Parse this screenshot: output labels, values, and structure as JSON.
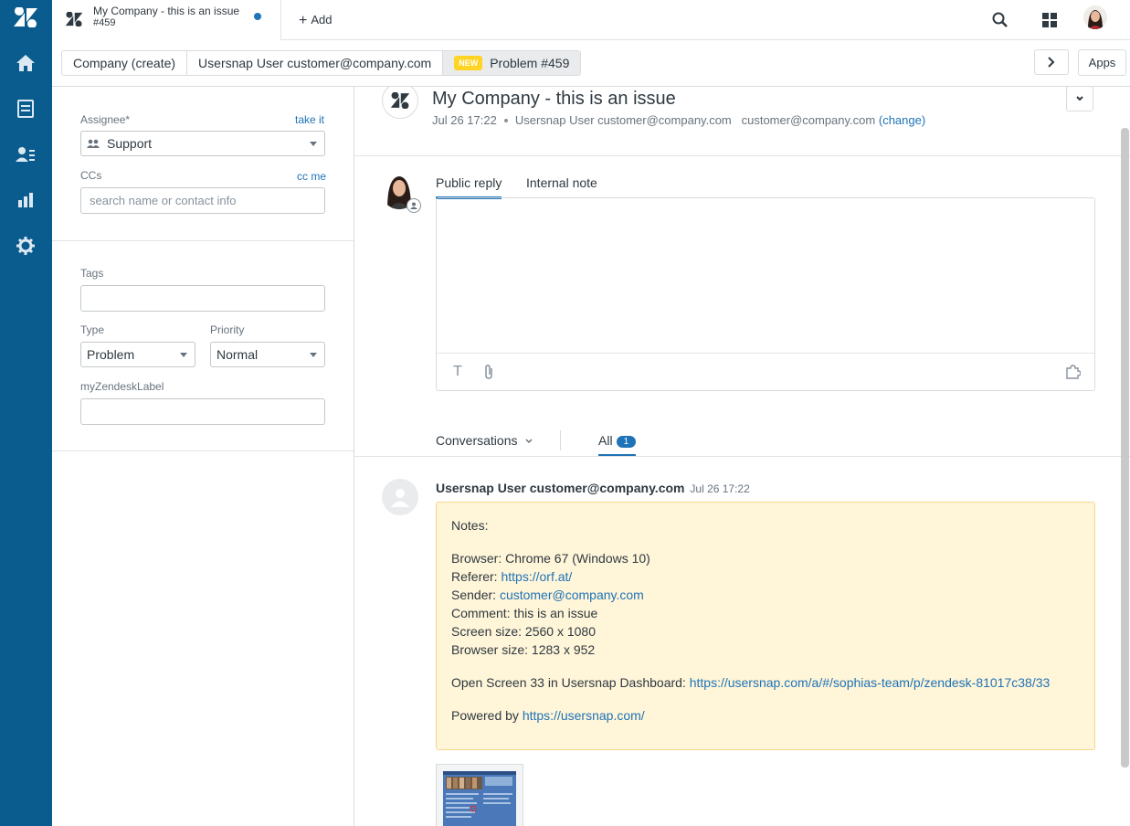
{
  "tab": {
    "title": "My Company - this is an issue",
    "number": "#459",
    "add_label": "Add"
  },
  "crumbs": {
    "organization": "Company (create)",
    "user": "Usersnap User customer@company.com",
    "status_badge": "NEW",
    "ticket": "Problem #459",
    "apps_label": "Apps"
  },
  "sidebar": {
    "assignee_label": "Assignee*",
    "take_it": "take it",
    "assignee_value": "Support",
    "ccs_label": "CCs",
    "cc_me": "cc me",
    "ccs_placeholder": "search name or contact info",
    "tags_label": "Tags",
    "type_label": "Type",
    "type_value": "Problem",
    "priority_label": "Priority",
    "priority_value": "Normal",
    "custom_label": "myZendeskLabel"
  },
  "ticket": {
    "title": "My Company - this is an issue",
    "date": "Jul 26 17:22",
    "requester": "Usersnap User customer@company.com",
    "email": "customer@company.com",
    "change": "(change)"
  },
  "reply": {
    "public_tab": "Public reply",
    "internal_tab": "Internal note"
  },
  "conversations": {
    "filter_label": "Conversations",
    "all_label": "All",
    "all_count": "1"
  },
  "message": {
    "author": "Usersnap User customer@company.com",
    "time": "Jul 26 17:22",
    "notes": "Notes:",
    "browser": "Browser: Chrome 67 (Windows 10)",
    "referer_label": "Referer: ",
    "referer_link": "https://orf.at/",
    "sender_label": "Sender: ",
    "sender_link": "customer@company.com",
    "comment": "Comment: this is an issue",
    "screen_size": "Screen size: 2560 x 1080",
    "browser_size": "Browser size: 1283 x 952",
    "open_screen_label": "Open Screen 33 in Usersnap Dashboard: ",
    "open_screen_link": "https://usersnap.com/a/#/sophias-team/p/zendesk-81017c38/33",
    "powered_label": "Powered by ",
    "powered_link": "https://usersnap.com/"
  },
  "colors": {
    "nav_bg": "#0a5c8e",
    "accent": "#1f73b7",
    "message_bg": "#fff5d8",
    "new_badge": "#ffd424"
  },
  "icons": [
    "zendesk-logo-icon",
    "home-icon",
    "views-icon",
    "customers-icon",
    "reporting-icon",
    "admin-gear-icon",
    "search-icon",
    "product-tray-icon",
    "text-format-icon",
    "attachment-icon",
    "apps-puzzle-icon",
    "chevron-right-icon",
    "chevron-down-icon"
  ]
}
